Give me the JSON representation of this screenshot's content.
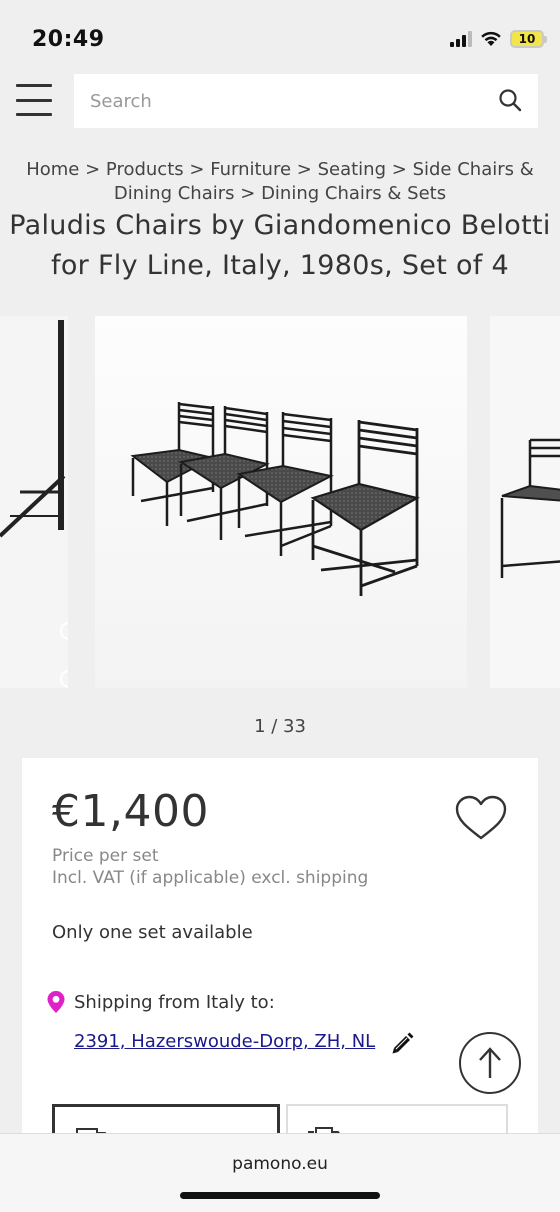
{
  "status_bar": {
    "time": "20:49",
    "battery": "10",
    "icons": [
      "signal-icon",
      "wifi-icon",
      "battery-icon"
    ]
  },
  "header": {
    "menu_icon": "hamburger-menu-icon",
    "search": {
      "placeholder": "Search",
      "value": "",
      "icon": "search-icon"
    }
  },
  "breadcrumb": {
    "items": [
      "Home",
      "Products",
      "Furniture",
      "Seating",
      "Side Chairs & Dining Chairs",
      "Dining Chairs & Sets"
    ],
    "separator": ">"
  },
  "product": {
    "title_line1": "Paludis Chairs by Giandomenico Belotti",
    "title_line2": "for Fly Line, Italy, 1980s, Set of 4"
  },
  "gallery": {
    "counter": "1 / 33"
  },
  "price_card": {
    "price": "€1,400",
    "price_per": "Price per set",
    "vat_note": "Incl. VAT (if applicable) excl. shipping",
    "availability": "Only one set available",
    "shipping_label": "Shipping from Italy to:",
    "shipping_address": "2391, Hazerswoude-Dorp, ZH, NL",
    "heart_icon": "heart-icon",
    "pin_icon": "location-pin-icon",
    "pencil_icon": "pencil-icon",
    "scroll_top_icon": "arrow-up-icon",
    "accent_color": "#e020c8"
  },
  "browser": {
    "url": "pamono.eu"
  }
}
